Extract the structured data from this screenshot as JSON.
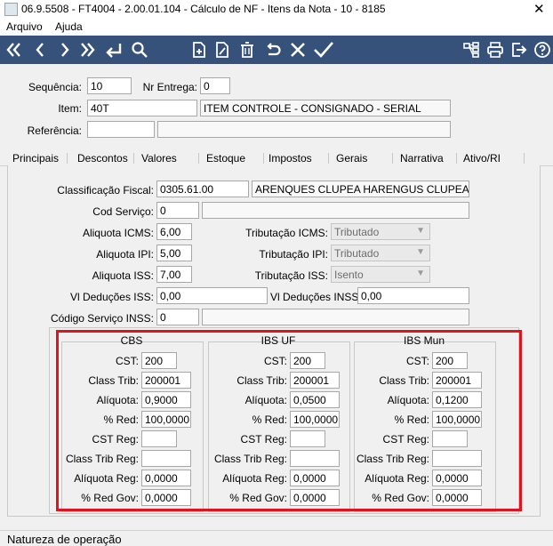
{
  "window": {
    "title": "06.9.5508 - FT4004 - 2.00.01.104 - Cálculo de NF - Itens da Nota - 10 - 8185",
    "close": "✕"
  },
  "menu": {
    "arquivo": "Arquivo",
    "ajuda": "Ajuda"
  },
  "toolbar": {
    "colors": {
      "background": "#37527a",
      "icon": "#ffffff"
    },
    "icons": [
      "first-icon",
      "previous-icon",
      "next-icon",
      "last-icon",
      "goto-icon",
      "search-icon",
      "new-icon",
      "edit-icon",
      "delete-icon",
      "undo-icon",
      "cancel-icon",
      "confirm-icon",
      "network-icon",
      "print-icon",
      "exit-icon",
      "help-icon"
    ]
  },
  "header": {
    "sequencia_label": "Sequência:",
    "sequencia": "10",
    "nr_entrega_label": "Nr Entrega:",
    "nr_entrega": "0",
    "item_label": "Item:",
    "item_code": "40T",
    "item_desc": "ITEM CONTROLE - CONSIGNADO - SERIAL",
    "referencia_label": "Referência:",
    "referencia": "",
    "referencia_desc": ""
  },
  "tabs": [
    "Principais",
    "Descontos",
    "Valores",
    "Estoque",
    "Impostos",
    "Gerais",
    "Narrativa",
    "Ativo/RI"
  ],
  "impostos": {
    "class_fiscal_label": "Classificação Fiscal:",
    "class_fiscal": "0305.61.00",
    "class_fiscal_desc": "ARENQUES CLUPEA HARENGUS CLUPEA PAL",
    "cod_servico_label": "Cod Serviço:",
    "cod_servico": "0",
    "cod_servico_desc": "",
    "aliq_icms_label": "Aliquota ICMS:",
    "aliq_icms": "6,00",
    "trib_icms_label": "Tributação ICMS:",
    "trib_icms": "Tributado",
    "aliq_ipi_label": "Aliquota IPI:",
    "aliq_ipi": "5,00",
    "trib_ipi_label": "Tributação IPI:",
    "trib_ipi": "Tributado",
    "aliq_iss_label": "Aliquota ISS:",
    "aliq_iss": "7,00",
    "trib_iss_label": "Tributação ISS:",
    "trib_iss": "Isento",
    "ded_iss_label": "Vl Deduções ISS:",
    "ded_iss": "0,00",
    "ded_inss_label": "Vl Deduções INSS:",
    "ded_inss": "0,00",
    "cod_serv_inss_label": "Código Serviço INSS:",
    "cod_serv_inss": "0",
    "cod_serv_inss_desc": ""
  },
  "labels": {
    "cst": "CST:",
    "class_trib": "Class Trib:",
    "aliquota": "Alíquota:",
    "red": "% Red:",
    "cst_reg": "CST Reg:",
    "class_trib_reg": "Class Trib Reg:",
    "aliquota_reg": "Alíquota Reg:",
    "red_gov": "% Red Gov:"
  },
  "groups": [
    {
      "title": "CBS",
      "cst": "200",
      "class_trib": "200001",
      "aliquota": "0,9000",
      "red": "100,0000",
      "cst_reg": "",
      "class_trib_reg": "",
      "aliquota_reg": "0,0000",
      "red_gov": "0,0000"
    },
    {
      "title": "IBS UF",
      "cst": "200",
      "class_trib": "200001",
      "aliquota": "0,0500",
      "red": "100,0000",
      "cst_reg": "",
      "class_trib_reg": "",
      "aliquota_reg": "0,0000",
      "red_gov": "0,0000"
    },
    {
      "title": "IBS Mun",
      "cst": "200",
      "class_trib": "200001",
      "aliquota": "0,1200",
      "red": "100,0000",
      "cst_reg": "",
      "class_trib_reg": "",
      "aliquota_reg": "0,0000",
      "red_gov": "0,0000"
    }
  ],
  "status": {
    "text": "Natureza de operação"
  },
  "highlight_color": "#e0141e"
}
